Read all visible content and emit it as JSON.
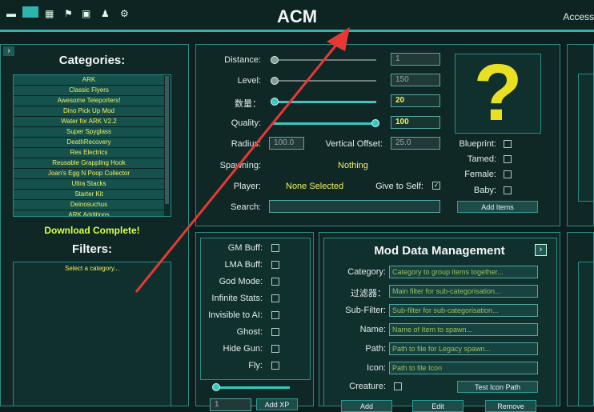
{
  "window": {
    "title": "ACM",
    "access_label": "Access"
  },
  "left": {
    "categories_title": "Categories:",
    "categories": [
      "ARK",
      "Classic Flyers",
      "Awesome Teleporters!",
      "Dino Pick Up Mod",
      "Water for ARK V2.2",
      "Super Spyglass",
      "DeathRecovery",
      "Res Electrics",
      "Reusable Grappling Hook",
      "Joan's Egg N Poop Collector",
      "Ultra Stacks",
      "Starter Kit",
      "Deinosuchus",
      "ARK Additions"
    ],
    "download_status": "Download Complete!",
    "filters_title": "Filters:",
    "filters_placeholder": "Select a category..."
  },
  "spawn": {
    "distance_label": "Distance:",
    "distance_value": "1",
    "level_label": "Level:",
    "level_value": "150",
    "quantity_label": "数量：",
    "quantity_value": "20",
    "quality_label": "Quality:",
    "quality_value": "100",
    "radius_label": "Radius:",
    "radius_value": "100.0",
    "voffset_label": "Vertical Offset:",
    "voffset_value": "25.0",
    "spawning_label": "Spawning:",
    "spawning_value": "Nothing",
    "player_label": "Player:",
    "player_value": "None Selected",
    "give_self_label": "Give to Self:",
    "search_label": "Search:",
    "unknown_glyph": "?",
    "blueprint_label": "Blueprint:",
    "tamed_label": "Tamed:",
    "female_label": "Female:",
    "baby_label": "Baby:",
    "add_items_label": "Add Items"
  },
  "buffs": {
    "items": [
      "GM Buff:",
      "LMA Buff:",
      "God Mode:",
      "Infinite Stats:",
      "Invisible to AI:",
      "Ghost:",
      "Hide Gun:",
      "Fly:"
    ],
    "xp_value": "1",
    "add_xp_label": "Add XP"
  },
  "mod_data": {
    "title": "Mod Data Management",
    "fields": [
      {
        "label": "Category:",
        "placeholder": "Category to group items together..."
      },
      {
        "label": "过滤器：",
        "placeholder": "Main filter for sub-categorisation..."
      },
      {
        "label": "Sub-Filter:",
        "placeholder": "Sub-filter for sub-categorisation..."
      },
      {
        "label": "Name:",
        "placeholder": "Name of Item to spawn..."
      },
      {
        "label": "Path:",
        "placeholder": "Path to file for Legacy spawn..."
      },
      {
        "label": "Icon:",
        "placeholder": "Path to file Icon"
      }
    ],
    "creature_label": "Creature:",
    "test_icon_label": "Test Icon Path",
    "bottom_buttons": [
      "Add",
      "Edit",
      "Remove"
    ]
  },
  "colors": {
    "accent": "#2fb3ad",
    "yellow_text": "#f3ef5f",
    "question_mark": "#e9df23",
    "arrow": "#e53935"
  }
}
